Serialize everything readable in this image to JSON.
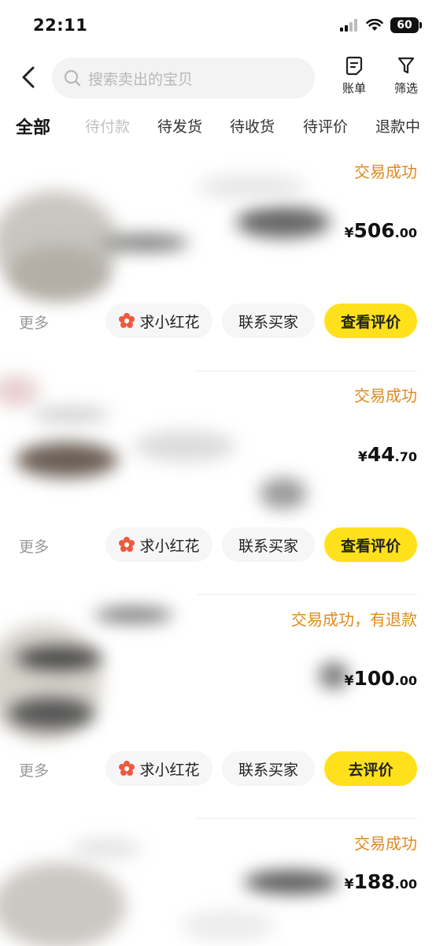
{
  "status_bar": {
    "time": "22:11",
    "battery": "60"
  },
  "header": {
    "search_placeholder": "搜索卖出的宝贝",
    "bill_label": "账单",
    "filter_label": "筛选"
  },
  "tabs": [
    "全部",
    "待付款",
    "待发货",
    "待收货",
    "待评价",
    "退款中"
  ],
  "orders": [
    {
      "status": "交易成功",
      "price_currency": "¥",
      "price_int": "506",
      "price_dec": ".00",
      "more": "更多",
      "flower": "求小红花",
      "contact": "联系买家",
      "review": "查看评价"
    },
    {
      "status": "交易成功",
      "price_currency": "¥",
      "price_int": "44",
      "price_dec": ".70",
      "more": "更多",
      "flower": "求小红花",
      "contact": "联系买家",
      "review": "查看评价"
    },
    {
      "status": "交易成功，有退款",
      "price_currency": "¥",
      "price_int": "100",
      "price_dec": ".00",
      "more": "更多",
      "flower": "求小红花",
      "contact": "联系买家",
      "review": "去评价"
    },
    {
      "status": "交易成功",
      "price_currency": "¥",
      "price_int": "188",
      "price_dec": ".00"
    }
  ],
  "colors": {
    "accent_yellow": "#ffe11b",
    "status_orange": "#e08a1e",
    "flower_red": "#f0593e"
  }
}
